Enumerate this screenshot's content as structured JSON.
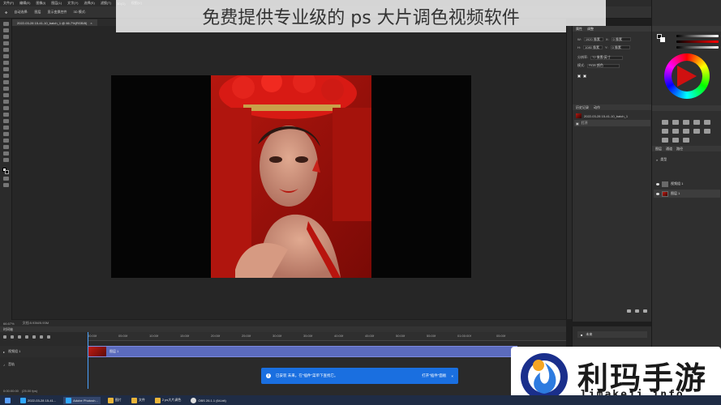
{
  "overlay": {
    "title": "免费提供专业级的 ps 大片调色视频软件"
  },
  "menu": {
    "items": [
      "文件(F)",
      "编辑(E)",
      "图像(I)",
      "图层(L)",
      "文字(Y)",
      "选择(S)",
      "滤镜(T)",
      "3D(D)",
      "视图(V)"
    ]
  },
  "options": {
    "auto_select": "自动选择:",
    "layer": "图层",
    "transform": "显示变换控件",
    "mode": "3D 模式:"
  },
  "document": {
    "tab_label": "2022-03-28 15-41-10_batch_1 @ 66.7%(RGB/8)",
    "close": "×"
  },
  "status": {
    "zoom": "66.67%",
    "info": "文档:5.93M/5.93M"
  },
  "timeline": {
    "title": "时间轴",
    "ticks": [
      "00:00f",
      "05:00f",
      "10:00f",
      "15:00f",
      "20:00f",
      "25:00f",
      "30:00f",
      "35:00f",
      "40:00f",
      "45:00f",
      "50:00f",
      "55:00f",
      "01:00:00f",
      "05:00f"
    ],
    "track": "视频组 1",
    "clip": "图层 1",
    "audio": "音轨",
    "fps": "0:00:00:00",
    "fps2": "(25.00 fps)"
  },
  "notification": {
    "message": "已安装 未来。在\"插件\"菜单下查找它。",
    "action": "打开\"插件\"面板"
  },
  "properties": {
    "tab1": "属性",
    "tab2": "调整",
    "w_label": "W:",
    "w_value": "1920 像素",
    "h_label": "H:",
    "h_value": "1080 像素",
    "x_label": "X:",
    "x_value": "0 像素",
    "y_label": "Y:",
    "y_value": "0 像素",
    "mode_label": "模式:",
    "mode_value": "RGB 颜色",
    "res_label": "分辨率:",
    "res_value": "72 像素/英寸"
  },
  "history": {
    "tab1": "历史记录",
    "tab2": "动作",
    "snapshot": "2022-03-28 15-41-10_batch_1",
    "state": "打开"
  },
  "actions": {
    "label": "未来"
  },
  "color_panel": {
    "fg": "#000000",
    "bg": "#ffffff",
    "accent": "#d01010"
  },
  "layers": {
    "tab1": "图层",
    "tab2": "通道",
    "tab3": "路径",
    "kind": "类型",
    "group": "视频组 1",
    "layer": "图层 1"
  },
  "logo": {
    "text": "利玛手游",
    "url": "limakeji.info"
  },
  "taskbar": {
    "items": [
      "2022-03-28 15-41...",
      "Adobe Photosh...",
      "图片",
      "文件",
      "2 ps大片调色",
      "OBS 26.1.1 (64-bit)"
    ]
  }
}
